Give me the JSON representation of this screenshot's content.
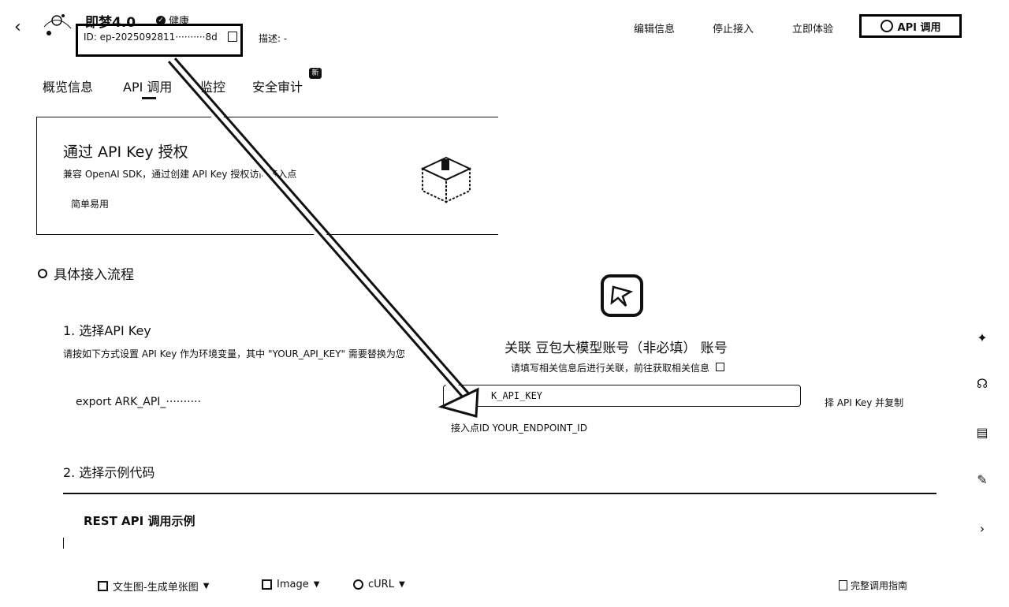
{
  "header": {
    "app_title": "即梦4.0",
    "status": "健康",
    "id_label": "ID: ep-2025092811··········8d",
    "desc_label": "描述: -",
    "links": [
      "编辑信息",
      "停止接入",
      "立即体验"
    ],
    "api_button": "API 调用"
  },
  "tabs": [
    "概览信息",
    "API 调用",
    "监控",
    "安全审计"
  ],
  "badge_new": "新",
  "auth_card": {
    "title": "通过 API Key 授权",
    "subtitle": "兼容 OpenAI SDK，通过创建 API Key 授权访问接入点",
    "tag": "简单易用"
  },
  "flow": {
    "heading": "具体接入流程",
    "step1_title": "1. 选择API Key",
    "step1_desc": "请按如下方式设置 API Key 作为环境变量，其中 \"YOUR_API_KEY\" 需要替换为您",
    "export_line": "export ARK_API_··········",
    "step2_title": "2. 选择示例代码"
  },
  "modal": {
    "title": "关联 豆包大模型账号（非必填） 账号",
    "subtitle": "请填写相关信息后进行关联，前往获取相关信息",
    "key_value": "K_API_KEY",
    "select_copy": "择 API Key 并复制",
    "endpoint_line": "接入点ID YOUR_ENDPOINT_ID"
  },
  "code": {
    "title": "REST API 调用示例",
    "dropdowns": [
      "文生图-生成单张图",
      "Image",
      "cURL"
    ],
    "guide": "完整调用指南"
  },
  "icons": [
    "back-arrow-icon",
    "copy-icon",
    "status-check-icon",
    "sparkle-icon",
    "headset-icon",
    "book-icon",
    "feedback-icon",
    "chevron-right-icon"
  ]
}
